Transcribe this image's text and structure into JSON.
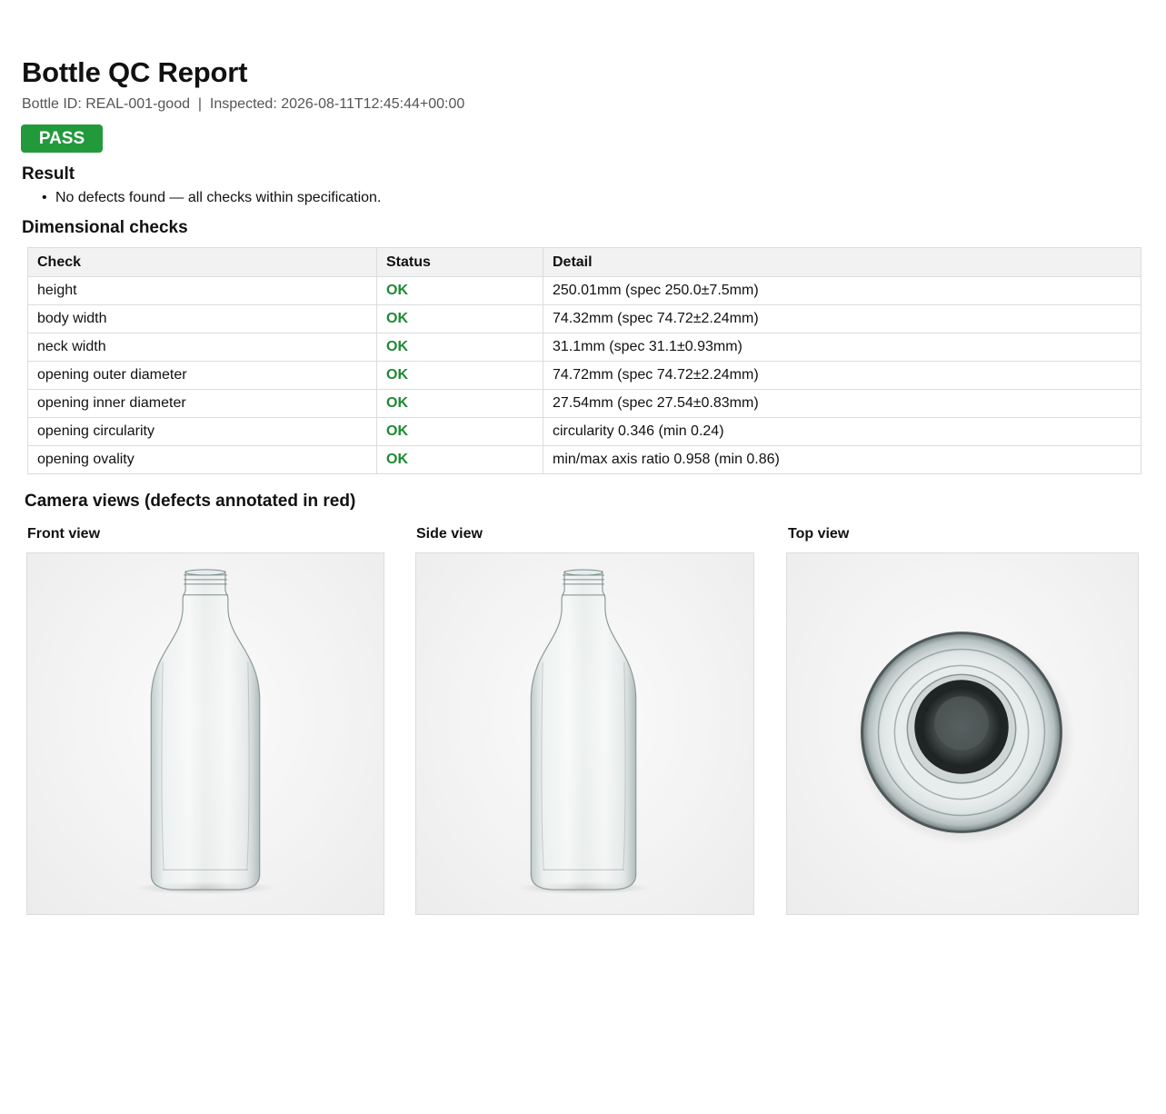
{
  "report": {
    "title": "Bottle QC Report",
    "meta": "Bottle ID: REAL-001-good  |  Inspected: 2026-08-11T12:45:44+00:00",
    "status_badge": "PASS",
    "status_color": "#229a3c"
  },
  "result": {
    "heading": "Result",
    "items": [
      "No defects found — all checks within specification."
    ]
  },
  "dimensional": {
    "heading": "Dimensional checks",
    "columns": [
      "Check",
      "Status",
      "Detail"
    ],
    "rows": [
      {
        "check": "height",
        "status": "OK",
        "detail": "250.01mm (spec 250.0±7.5mm)"
      },
      {
        "check": "body width",
        "status": "OK",
        "detail": "74.32mm (spec 74.72±2.24mm)"
      },
      {
        "check": "neck width",
        "status": "OK",
        "detail": "31.1mm (spec 31.1±0.93mm)"
      },
      {
        "check": "opening outer diameter",
        "status": "OK",
        "detail": "74.72mm (spec 74.72±2.24mm)"
      },
      {
        "check": "opening inner diameter",
        "status": "OK",
        "detail": "27.54mm (spec 27.54±0.83mm)"
      },
      {
        "check": "opening circularity",
        "status": "OK",
        "detail": "circularity 0.346 (min 0.24)"
      },
      {
        "check": "opening ovality",
        "status": "OK",
        "detail": "min/max axis ratio 0.958 (min 0.86)"
      }
    ],
    "ok_color": "#1e8a34"
  },
  "cameras": {
    "heading": "Camera views (defects annotated in red)",
    "views": [
      {
        "label": "Front view",
        "icon": "bottle-front-image"
      },
      {
        "label": "Side view",
        "icon": "bottle-side-image"
      },
      {
        "label": "Top view",
        "icon": "bottle-top-image"
      }
    ]
  }
}
